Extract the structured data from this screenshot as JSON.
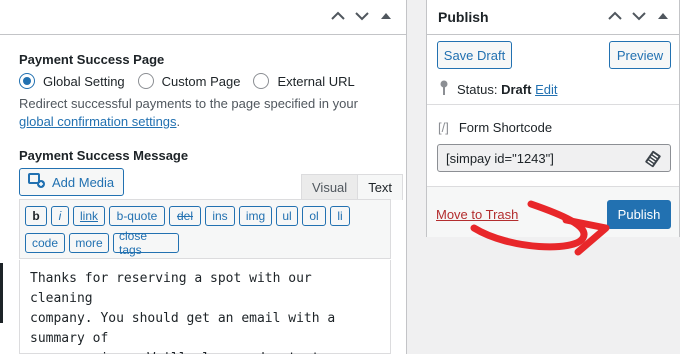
{
  "payment_success_page": {
    "title": "Payment Success Page",
    "options": [
      {
        "label": "Global Setting",
        "checked": true
      },
      {
        "label": "Custom Page",
        "checked": false
      },
      {
        "label": "External URL",
        "checked": false
      }
    ],
    "help_prefix": "Redirect successful payments to the page specified in your ",
    "help_link": "global confirmation settings",
    "help_suffix": "."
  },
  "payment_success_message": {
    "title": "Payment Success Message",
    "add_media_label": "Add Media",
    "tabs": [
      {
        "label": "Visual",
        "active": false
      },
      {
        "label": "Text",
        "active": true
      }
    ],
    "toolbar": [
      "b",
      "i",
      "link",
      "b-quote",
      "del",
      "ins",
      "img",
      "ul",
      "ol",
      "li",
      "code",
      "more",
      "close tags"
    ],
    "content": "Thanks for reserving a spot with our cleaning\ncompany. You should get an email with a summary of\nyour services. We'll also send a text message\nduring the day of the appointment."
  },
  "publish_box": {
    "title": "Publish",
    "save_draft_label": "Save Draft",
    "preview_label": "Preview",
    "status_label": "Status:",
    "status_value": "Draft",
    "status_edit": "Edit",
    "shortcode_icon_text": "[/]",
    "shortcode_label": "Form Shortcode",
    "shortcode_value": "[simpay id=\"1243\"]",
    "move_to_trash": "Move to Trash",
    "publish_label": "Publish"
  },
  "colors": {
    "accent": "#2271b1",
    "trash": "#b32d2e",
    "annotation_arrow": "#e8272a"
  }
}
